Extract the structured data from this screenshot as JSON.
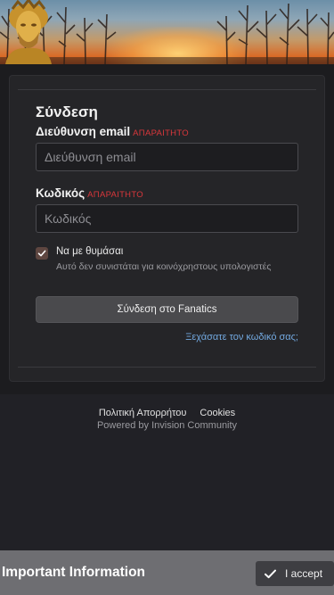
{
  "login": {
    "title": "Σύνδεση",
    "email_label": "Διεύθυνση email",
    "required_tag": "ΑΠΑΡΑΙΤΗΤΟ",
    "email_placeholder": "Διεύθυνση email",
    "password_label": "Κωδικός",
    "password_placeholder": "Κωδικός",
    "remember_label": "Να με θυμάσαι",
    "remember_checked": true,
    "remember_desc": "Αυτό δεν συνιστάται για κοινόχρηστους υπολογιστές",
    "submit_label": "Σύνδεση στο Fanatics",
    "forgot_label": "Ξεχάσατε τον κωδικό σας;"
  },
  "footer": {
    "privacy": "Πολιτική Απορρήτου",
    "cookies": "Cookies",
    "powered": "Powered by Invision Community"
  },
  "notice": {
    "title": "Important Information",
    "accept_label": "I accept",
    "accept_icon": "check-icon"
  },
  "colors": {
    "required": "#d9373b",
    "link": "#72a8df",
    "background": "#212126",
    "button": "#4a4a4d"
  }
}
